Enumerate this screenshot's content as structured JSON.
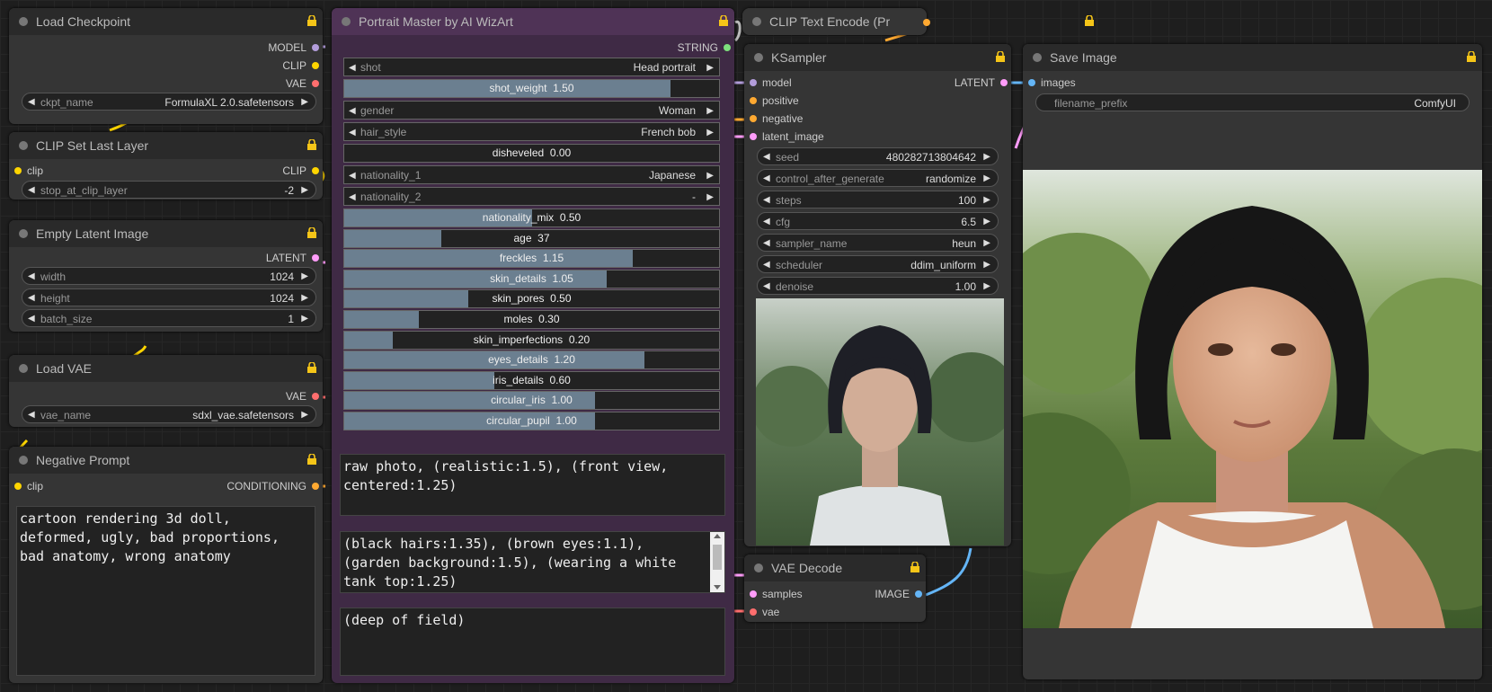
{
  "nodes": {
    "load_checkpoint": {
      "title": "Load Checkpoint",
      "outputs": [
        "MODEL",
        "CLIP",
        "VAE"
      ],
      "ckpt_label": "ckpt_name",
      "ckpt_value": "FormulaXL 2.0.safetensors"
    },
    "clip_set_last_layer": {
      "title": "CLIP Set Last Layer",
      "input": "clip",
      "output": "CLIP",
      "label": "stop_at_clip_layer",
      "value": "-2"
    },
    "empty_latent": {
      "title": "Empty Latent Image",
      "output": "LATENT",
      "widgets": [
        {
          "label": "width",
          "value": "1024"
        },
        {
          "label": "height",
          "value": "1024"
        },
        {
          "label": "batch_size",
          "value": "1"
        }
      ]
    },
    "load_vae": {
      "title": "Load VAE",
      "output": "VAE",
      "label": "vae_name",
      "value": "sdxl_vae.safetensors"
    },
    "negative_prompt": {
      "title": "Negative Prompt",
      "input": "clip",
      "output": "CONDITIONING",
      "text": "cartoon rendering 3d doll,\ndeformed, ugly, bad proportions,\nbad anatomy, wrong anatomy"
    },
    "portrait_master": {
      "title": "Portrait Master by AI WizArt",
      "output": "STRING",
      "combos": [
        {
          "label": "shot",
          "value": "Head portrait"
        }
      ],
      "shot_weight": {
        "label": "shot_weight",
        "value": "1.50",
        "fraction": 0.87
      },
      "gender": {
        "label": "gender",
        "value": "Woman"
      },
      "hair_style": {
        "label": "hair_style",
        "value": "French bob"
      },
      "disheveled": {
        "label": "disheveled",
        "value": "0.00",
        "fraction": 0.0
      },
      "nationality_1": {
        "label": "nationality_1",
        "value": "Japanese"
      },
      "nationality_2": {
        "label": "nationality_2",
        "value": "-"
      },
      "sliders": [
        {
          "label": "nationality_mix",
          "value": "0.50",
          "fraction": 0.5
        },
        {
          "label": "age",
          "value": "37",
          "fraction": 0.26
        },
        {
          "label": "freckles",
          "value": "1.15",
          "fraction": 0.77
        },
        {
          "label": "skin_details",
          "value": "1.05",
          "fraction": 0.7
        },
        {
          "label": "skin_pores",
          "value": "0.50",
          "fraction": 0.33
        },
        {
          "label": "moles",
          "value": "0.30",
          "fraction": 0.2
        },
        {
          "label": "skin_imperfections",
          "value": "0.20",
          "fraction": 0.13
        },
        {
          "label": "eyes_details",
          "value": "1.20",
          "fraction": 0.8
        },
        {
          "label": "iris_details",
          "value": "0.60",
          "fraction": 0.4
        },
        {
          "label": "circular_iris",
          "value": "1.00",
          "fraction": 0.67
        },
        {
          "label": "circular_pupil",
          "value": "1.00",
          "fraction": 0.67
        }
      ],
      "text_1": "raw photo, (realistic:1.5), (front view,\ncentered:1.25)",
      "text_2": "(black hairs:1.35), (brown eyes:1.1),\n(garden background:1.5), (wearing a white\ntank top:1.25)",
      "text_3": "(deep of field)"
    },
    "clip_text_encode": {
      "title": "CLIP Text Encode (Pr"
    },
    "ksampler": {
      "title": "KSampler",
      "inputs": [
        "model",
        "positive",
        "negative",
        "latent_image"
      ],
      "output": "LATENT",
      "widgets": [
        {
          "label": "seed",
          "value": "480282713804642"
        },
        {
          "label": "control_after_generate",
          "value": "randomize"
        },
        {
          "label": "steps",
          "value": "100"
        },
        {
          "label": "cfg",
          "value": "6.5"
        },
        {
          "label": "sampler_name",
          "value": "heun"
        },
        {
          "label": "scheduler",
          "value": "ddim_uniform"
        },
        {
          "label": "denoise",
          "value": "1.00"
        }
      ]
    },
    "vae_decode": {
      "title": "VAE Decode",
      "inputs": [
        "samples",
        "vae"
      ],
      "output": "IMAGE"
    },
    "save_image": {
      "title": "Save Image",
      "input": "images",
      "label": "filename_prefix",
      "value": "ComfyUI"
    }
  },
  "colors": {
    "model": "#b39ddb",
    "clip": "#ffd500",
    "vae": "#ff6e6e",
    "latent": "#ff9cf9",
    "conditioning": "#ffa931",
    "image": "#64b5f6",
    "string": "#7de07d"
  },
  "icons": {
    "arrow_left": "◀",
    "arrow_right": "▶",
    "lock": "lock-icon"
  }
}
